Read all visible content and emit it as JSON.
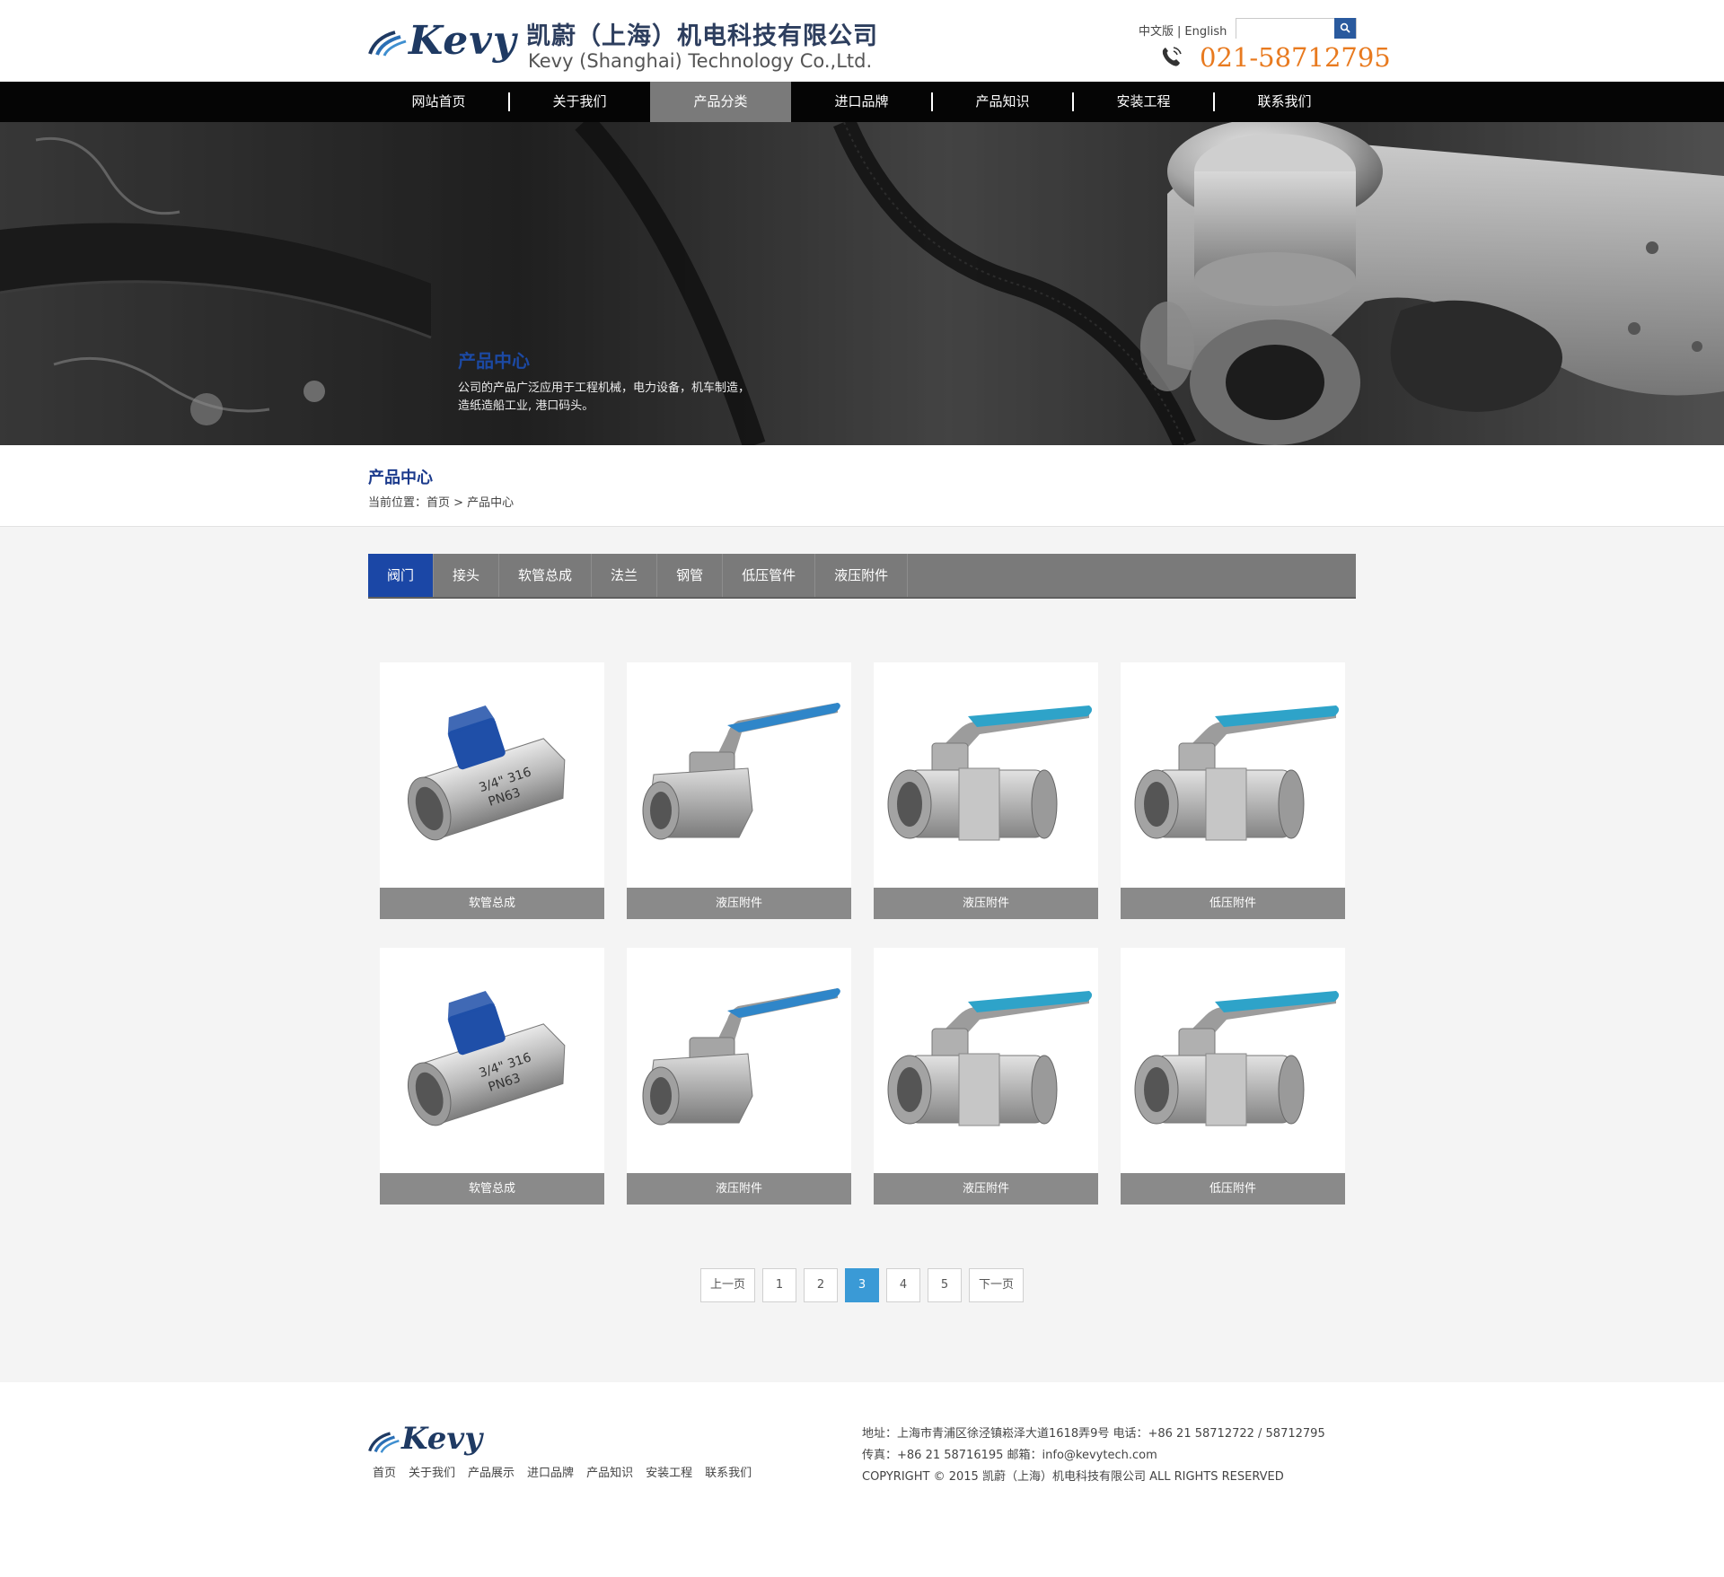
{
  "header": {
    "logo_text": "Kevy",
    "company_cn": "凯蔚（上海）机电科技有限公司",
    "company_en": "Kevy (Shanghai) Technology Co.,Ltd.",
    "lang_cn": "中文版",
    "lang_sep": "|",
    "lang_en": "English",
    "search_value": "",
    "search_icon": "magnifier-icon",
    "phone_icon": "telephone-icon",
    "phone": "021-58712795"
  },
  "nav": {
    "items": [
      {
        "label": "网站首页"
      },
      {
        "label": "关于我们"
      },
      {
        "label": "产品分类"
      },
      {
        "label": "进口品牌"
      },
      {
        "label": "产品知识"
      },
      {
        "label": "安装工程"
      },
      {
        "label": "联系我们"
      }
    ],
    "active_index": 2
  },
  "banner": {
    "title": "产品中心",
    "text_line1": "公司的产品广泛应用于工程机械，电力设备，机车制造，",
    "text_line2": "造纸造船工业, 港口码头。"
  },
  "page": {
    "title": "产品中心",
    "breadcrumb": "当前位置：首页 > 产品中心"
  },
  "tabs": [
    {
      "label": "阀门"
    },
    {
      "label": "接头"
    },
    {
      "label": "软管总成"
    },
    {
      "label": "法兰"
    },
    {
      "label": "钢管"
    },
    {
      "label": "低压管件"
    },
    {
      "label": "液压附件"
    }
  ],
  "products": [
    {
      "label": "软管总成",
      "kind": "mini-valve",
      "handle_color": "#1f4fa8"
    },
    {
      "label": "液压附件",
      "kind": "lever-valve",
      "handle_color": "#2f86c9"
    },
    {
      "label": "液压附件",
      "kind": "two-piece-valve",
      "handle_color": "#2ea3c9"
    },
    {
      "label": "低压附件",
      "kind": "two-piece-valve",
      "handle_color": "#2ea3c9"
    },
    {
      "label": "软管总成",
      "kind": "mini-valve",
      "handle_color": "#1f4fa8"
    },
    {
      "label": "液压附件",
      "kind": "lever-valve",
      "handle_color": "#2f86c9"
    },
    {
      "label": "液压附件",
      "kind": "two-piece-valve",
      "handle_color": "#2ea3c9"
    },
    {
      "label": "低压附件",
      "kind": "two-piece-valve",
      "handle_color": "#2ea3c9"
    }
  ],
  "pagination": {
    "prev": "上一页",
    "pages": [
      "1",
      "2",
      "3",
      "4",
      "5"
    ],
    "current": "3",
    "next": "下一页"
  },
  "footer": {
    "logo_text": "Kevy",
    "links": [
      "首页",
      "关于我们",
      "产品展示",
      "进口品牌",
      "产品知识",
      "安装工程",
      "联系我们"
    ],
    "address_line": "地址：上海市青浦区徐泾镇崧泽大道1618弄9号  电话：+86 21 58712722 / 58712795",
    "fax_line": "传真：+86 21 58716195  邮箱：info@kevytech.com",
    "copyright": "COPYRIGHT © 2015 凯蔚（上海）机电科技有限公司  ALL RIGHTS RESERVED"
  },
  "colors": {
    "brand_blue": "#1b47a6",
    "phone_orange": "#e87a1f",
    "pager_active": "#3a9ad6"
  }
}
